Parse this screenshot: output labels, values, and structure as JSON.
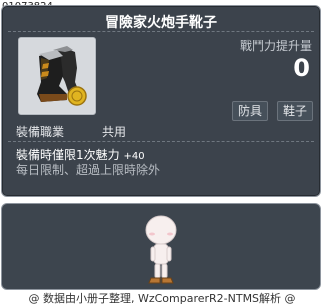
{
  "item_id": "01073824",
  "item": {
    "name": "冒險家火炮手靴子",
    "icon": "cannoneer-boots-icon",
    "combat_power_label": "戰鬥力提升量",
    "combat_power_value": "0",
    "tags": [
      "防具",
      "鞋子"
    ],
    "job_label": "裝備職業",
    "job_value": "共用",
    "equip_restriction": "裝備時僅限1次魅力",
    "equip_restriction_amount": "+40",
    "limit_text": "每日限制、超過上限時除外"
  },
  "preview": {
    "avatar": "blank-character-avatar"
  },
  "footer": "@ 数据由小册子整理, WzComparerR2-NTMS解析 @"
}
